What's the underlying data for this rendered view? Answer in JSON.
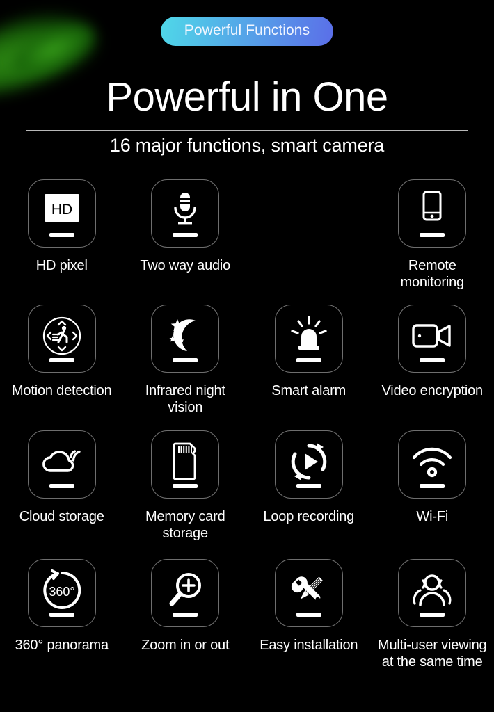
{
  "badge": {
    "label": "Powerful Functions",
    "gradient_from": "#4fd8e8",
    "gradient_to": "#5b6ee8"
  },
  "heading": {
    "title": "Powerful in One",
    "subtitle": "16 major functions, smart camera"
  },
  "theme": {
    "background": "#000000",
    "text": "#ffffff",
    "tile_border": "#6e6e6e",
    "divider": "#b9b9b9",
    "leaf_accent": "#2f8a14"
  },
  "features": [
    [
      {
        "label": "HD pixel",
        "icon": "hd-monitor-icon"
      },
      {
        "label": "Two way audio",
        "icon": "microphone-icon"
      },
      {
        "label": "",
        "icon": ""
      },
      {
        "label": "Remote monitoring",
        "icon": "smartphone-icon"
      }
    ],
    [
      {
        "label": "Motion detection",
        "icon": "motion-detection-icon"
      },
      {
        "label": "Infrared night vision",
        "icon": "moon-stars-icon"
      },
      {
        "label": "Smart alarm",
        "icon": "siren-alarm-icon"
      },
      {
        "label": "Video encryption",
        "icon": "video-camera-icon"
      }
    ],
    [
      {
        "label": "Cloud storage",
        "icon": "cloud-wifi-icon"
      },
      {
        "label": "Memory card storage",
        "icon": "sd-card-icon"
      },
      {
        "label": "Loop recording",
        "icon": "loop-play-icon"
      },
      {
        "label": "Wi-Fi",
        "icon": "wifi-icon"
      }
    ],
    [
      {
        "label": "360° panorama",
        "icon": "panorama-360-icon"
      },
      {
        "label": "Zoom in or out",
        "icon": "magnifier-plus-icon"
      },
      {
        "label": "Easy installation",
        "icon": "wrench-screwdriver-icon"
      },
      {
        "label": "Multi-user viewing\nat the same time",
        "icon": "multi-user-icon"
      }
    ]
  ],
  "icon_text": {
    "hd": "HD",
    "panorama": "360°"
  }
}
